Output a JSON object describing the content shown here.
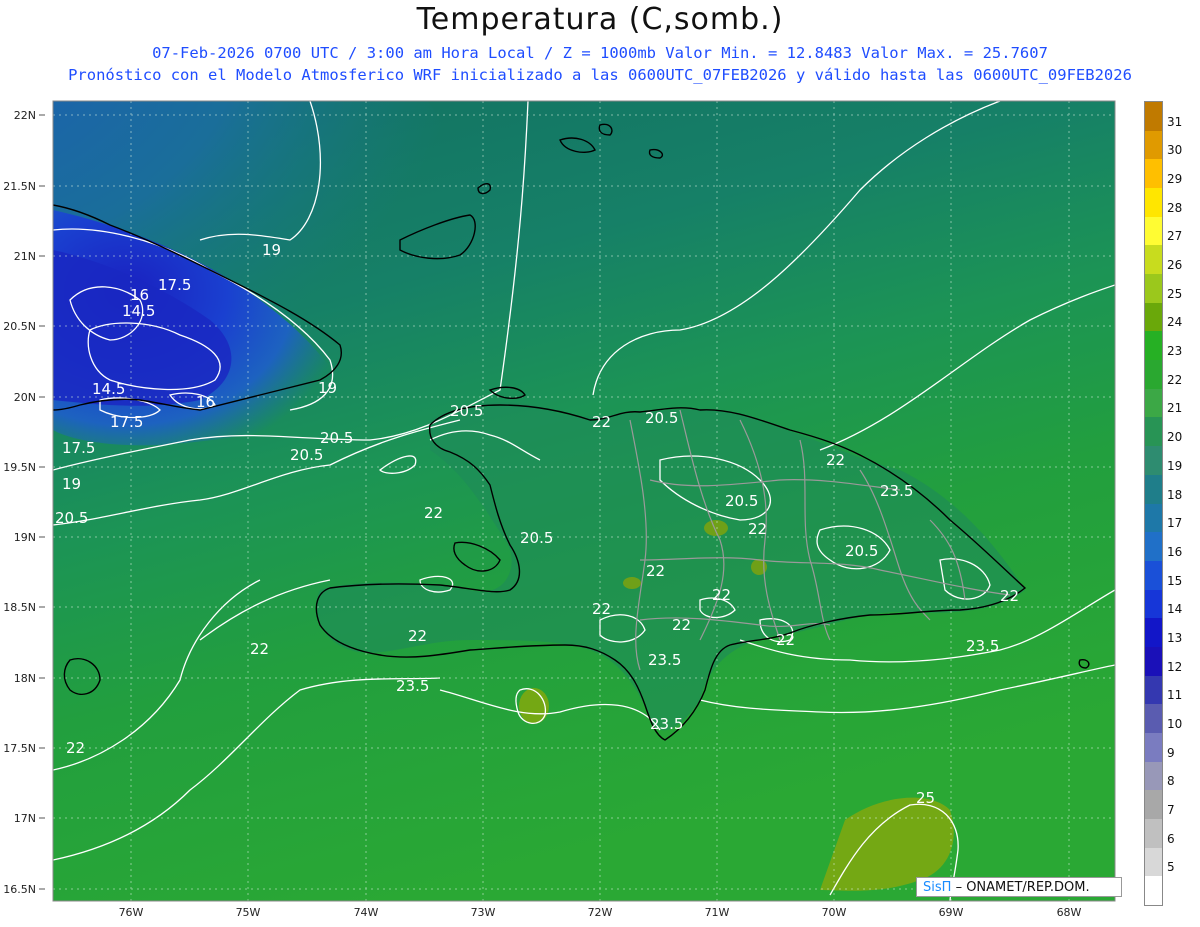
{
  "header": {
    "title": "Temperatura (C,somb.)",
    "line1": "07-Feb-2026 0700 UTC / 3:00 am Hora Local / Z = 1000mb   Valor Min. = 12.8483  Valor Max. = 25.7607",
    "line2": "Pronóstico con el Modelo Atmosferico WRF inicializado a las 0600UTC_07FEB2026 y válido hasta las  0600UTC_09FEB2026"
  },
  "axes": {
    "lat_labels": [
      "22N",
      "21.5N",
      "21N",
      "20.5N",
      "20N",
      "19.5N",
      "19N",
      "18.5N",
      "18N",
      "17.5N",
      "17N",
      "16.5N"
    ],
    "lon_labels": [
      "76W",
      "75W",
      "74W",
      "73W",
      "72W",
      "71W",
      "70W",
      "69W",
      "68W"
    ]
  },
  "contour_labels": [
    {
      "text": "19"
    },
    {
      "text": "17.5"
    },
    {
      "text": "16"
    },
    {
      "text": "14.5"
    },
    {
      "text": "14.5"
    },
    {
      "text": "17.5"
    },
    {
      "text": "16"
    },
    {
      "text": "19"
    },
    {
      "text": "17.5"
    },
    {
      "text": "20.5"
    },
    {
      "text": "19"
    },
    {
      "text": "20.5"
    },
    {
      "text": "20.5"
    },
    {
      "text": "20.5"
    },
    {
      "text": "22"
    },
    {
      "text": "20.5"
    },
    {
      "text": "22"
    },
    {
      "text": "23.5"
    },
    {
      "text": "20.5"
    },
    {
      "text": "22"
    },
    {
      "text": "20.5"
    },
    {
      "text": "22"
    },
    {
      "text": "22"
    },
    {
      "text": "22"
    },
    {
      "text": "22"
    },
    {
      "text": "22"
    },
    {
      "text": "22"
    },
    {
      "text": "23.5"
    },
    {
      "text": "22"
    },
    {
      "text": "23.5"
    },
    {
      "text": "22"
    },
    {
      "text": "22"
    },
    {
      "text": "23.5"
    },
    {
      "text": "23.5"
    },
    {
      "text": "22"
    },
    {
      "text": "25"
    }
  ],
  "legend": {
    "items": [
      {
        "label": "31",
        "color": "#c07a00"
      },
      {
        "label": "30",
        "color": "#e09a00"
      },
      {
        "label": "29",
        "color": "#ffbf00"
      },
      {
        "label": "28",
        "color": "#ffe600"
      },
      {
        "label": "27",
        "color": "#fffc33"
      },
      {
        "label": "26",
        "color": "#c8dc1e"
      },
      {
        "label": "25",
        "color": "#9bc81c"
      },
      {
        "label": "24",
        "color": "#6aa80a"
      },
      {
        "label": "23",
        "color": "#26b024"
      },
      {
        "label": "22",
        "color": "#2aa830"
      },
      {
        "label": "21",
        "color": "#3ca846"
      },
      {
        "label": "20",
        "color": "#289455"
      },
      {
        "label": "19",
        "color": "#2e8c70"
      },
      {
        "label": "18",
        "color": "#1f7e8a"
      },
      {
        "label": "17",
        "color": "#1e78a8"
      },
      {
        "label": "16",
        "color": "#2070c8"
      },
      {
        "label": "15",
        "color": "#1a50d8"
      },
      {
        "label": "14",
        "color": "#1636d8"
      },
      {
        "label": "13",
        "color": "#1216c8"
      },
      {
        "label": "12",
        "color": "#1a10b8"
      },
      {
        "label": "11",
        "color": "#3438b0"
      },
      {
        "label": "10",
        "color": "#5a5cb0"
      },
      {
        "label": "9",
        "color": "#7a7cc0"
      },
      {
        "label": "8",
        "color": "#9898b8"
      },
      {
        "label": "7",
        "color": "#a8a8a8"
      },
      {
        "label": "6",
        "color": "#c0c0c0"
      },
      {
        "label": "5",
        "color": "#d8d8d8"
      },
      {
        "label": "",
        "color": "#ffffff"
      }
    ]
  },
  "credit": {
    "brand": "SisΠ",
    "org": "– ONAMET/REP.DOM."
  },
  "colors": {
    "ocean_south": "#2aa534",
    "ocean_mid": "#1d9450",
    "ocean_north": "#14756f",
    "cold_core": "#1a2fbf",
    "warm_patch": "#7aa814",
    "contour": "#ffffff",
    "coast": "#000000",
    "province_border": "#9a9a9a"
  }
}
